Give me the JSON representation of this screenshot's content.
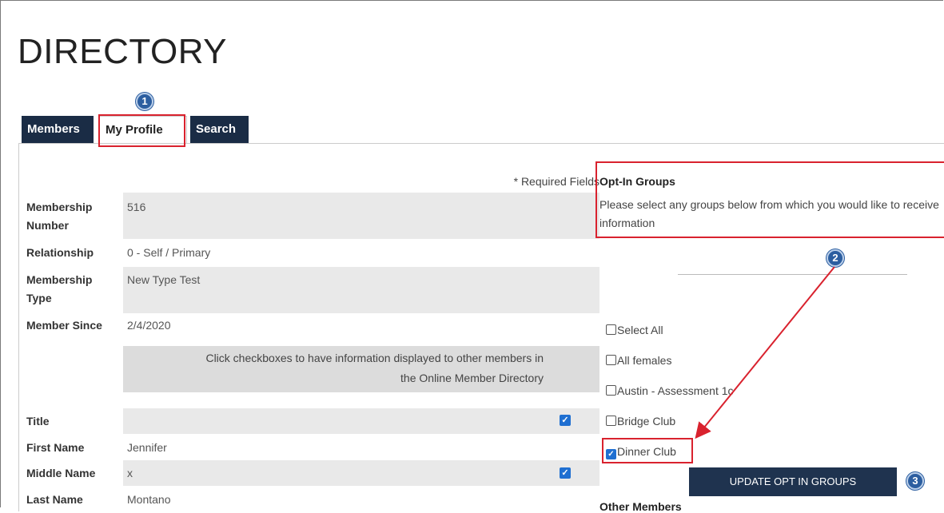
{
  "page": {
    "title": "DIRECTORY"
  },
  "tabs": [
    {
      "label": "Members"
    },
    {
      "label": "My Profile"
    },
    {
      "label": "Search"
    }
  ],
  "annotations": {
    "step1": "1",
    "step2": "2",
    "step3": "3"
  },
  "form": {
    "required_note": "* Required Fields",
    "membership_number": {
      "label_line1": "Membership",
      "label_line2": "Number",
      "value": "516"
    },
    "relationship": {
      "label": "Relationship",
      "value": "0 - Self / Primary"
    },
    "membership_type": {
      "label_line1": "Membership",
      "label_line2": "Type",
      "value": "New Type Test"
    },
    "member_since": {
      "label": "Member Since",
      "value": "2/4/2020"
    },
    "notice_line1": "Click checkboxes to have information displayed to other members in",
    "notice_line2": "the Online Member Directory",
    "title": {
      "label": "Title",
      "value": "",
      "show": true
    },
    "first_name": {
      "label": "First Name",
      "value": "Jennifer"
    },
    "middle_name": {
      "label": "Middle Name",
      "value": "x",
      "show": true
    },
    "last_name": {
      "label": "Last Name",
      "value": "Montano"
    }
  },
  "opt_in": {
    "title": "Opt-In Groups",
    "description": "Please select any groups below from which you would like to receive information",
    "groups": [
      {
        "label": "Select All",
        "checked": false
      },
      {
        "label": "All females",
        "checked": false
      },
      {
        "label": "Austin - Assessment 1c",
        "checked": false
      },
      {
        "label": "Bridge Club",
        "checked": false
      },
      {
        "label": "Dinner Club",
        "checked": true
      }
    ],
    "update_button": "UPDATE OPT IN GROUPS",
    "other_members": "Other Members"
  },
  "colors": {
    "tab_dark": "#1a2c45",
    "annotation_red": "#d9222e",
    "annotation_blue": "#2c5ea0",
    "button": "#1f334f",
    "checkbox": "#1f6fd1"
  }
}
